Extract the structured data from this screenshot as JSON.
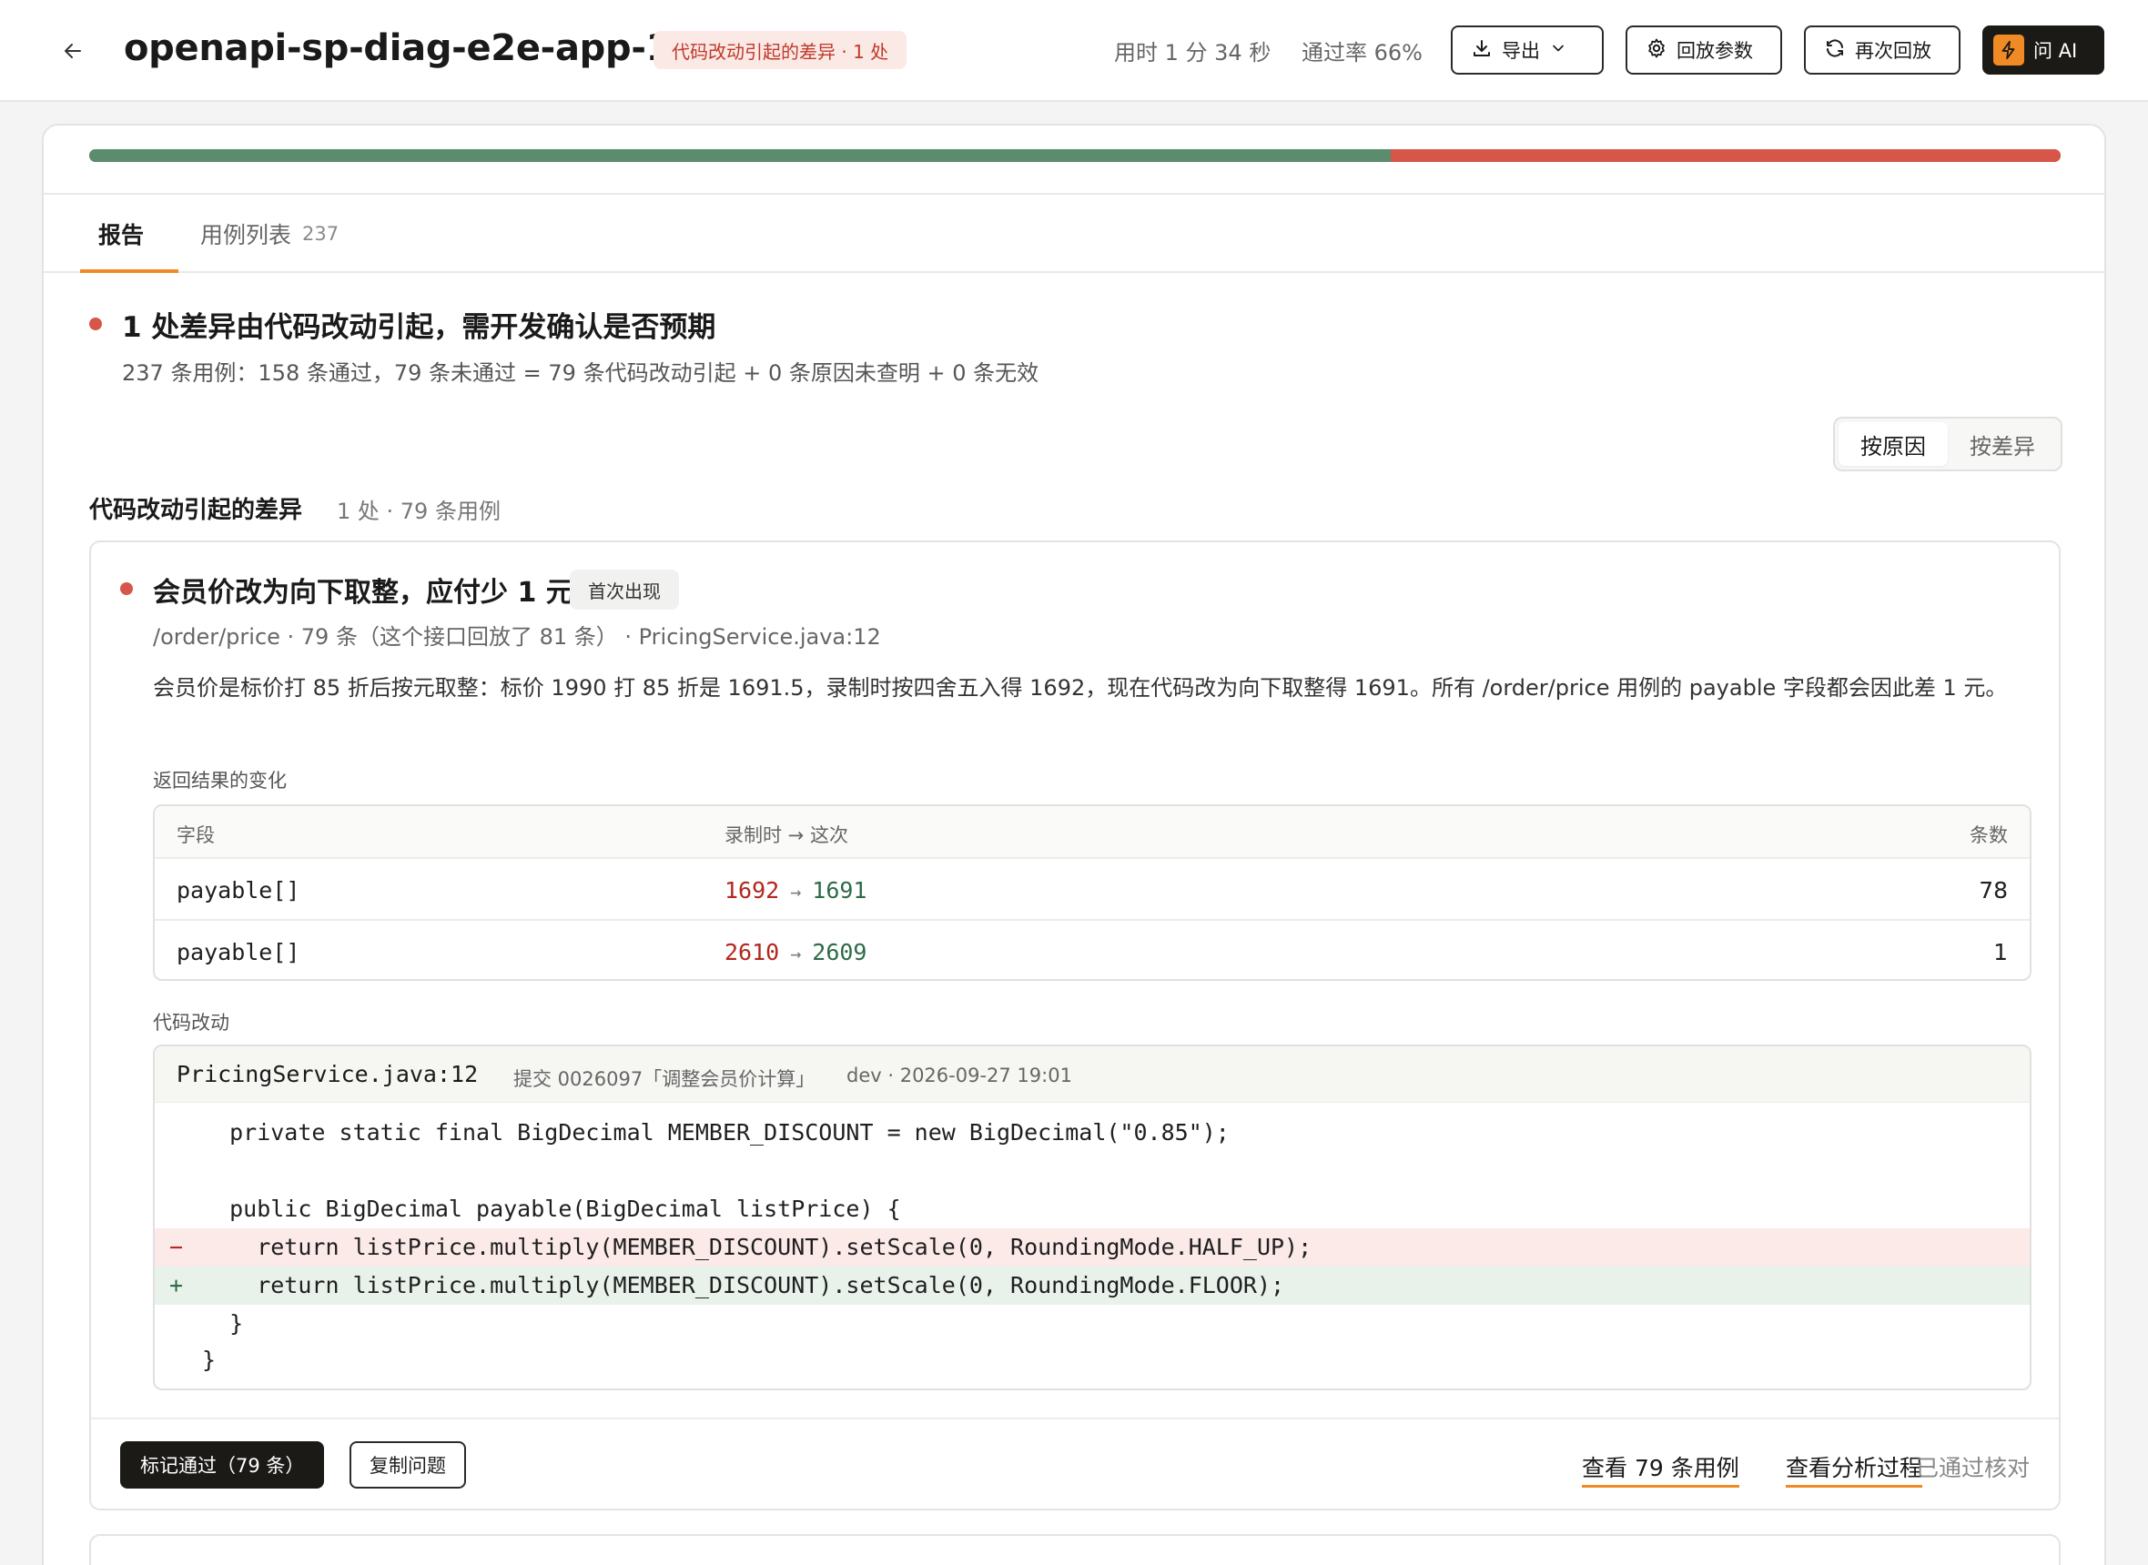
{
  "header": {
    "title": "openapi-sp-diag-e2e-app-130",
    "badge": "代码改动引起的差异 · 1 处",
    "duration": "用时 1 分 34 秒",
    "pass_rate": "通过率 66%",
    "buttons": {
      "export": "导出",
      "params": "回放参数",
      "replay": "再次回放",
      "ai": "问 AI"
    }
  },
  "progress": {
    "pass_fraction": 0.66,
    "pass_color": "#5b8c6d",
    "fail_color": "#d6574a"
  },
  "tabs": [
    {
      "label": "报告"
    },
    {
      "label": "用例列表",
      "count": "237"
    }
  ],
  "summary": {
    "title": "1 处差异由代码改动引起，需开发确认是否预期",
    "subtitle": "237 条用例：158 条通过，79 条未通过 = 79 条代码改动引起 + 0 条原因未查明 + 0 条无效"
  },
  "view_toggle": {
    "by_cause": "按原因",
    "by_diff": "按差异"
  },
  "section": {
    "title": "代码改动引起的差异",
    "meta": "1 处 · 79 条用例"
  },
  "issue": {
    "title": "会员价改为向下取整，应付少 1 元",
    "badge": "首次出现",
    "path": "/order/price · 79 条（这个接口回放了 81 条） · PricingService.java:12",
    "description": "会员价是标价打 85 折后按元取整：标价 1990 打 85 折是 1691.5，录制时按四舍五入得 1692，现在代码改为向下取整得 1691。所有 /order/price 用例的 payable 字段都会因此差 1 元。",
    "changes_label": "返回结果的变化",
    "table": {
      "headers": {
        "field": "字段",
        "change": "录制时 → 这次",
        "count": "条数"
      },
      "rows": [
        {
          "field": "payable[]",
          "old": "1692",
          "new": "1691",
          "count": "78"
        },
        {
          "field": "payable[]",
          "old": "2610",
          "new": "2609",
          "count": "1"
        }
      ],
      "arrow": "→"
    },
    "code_label": "代码改动",
    "code": {
      "file": "PricingService.java:12",
      "commit": "提交 0026097「调整会员价计算」",
      "branch": "dev · 2026-09-27 19:01",
      "lines": [
        {
          "marker": "",
          "text": "  private static final BigDecimal MEMBER_DISCOUNT = new BigDecimal(\"0.85\");",
          "kind": "ctx"
        },
        {
          "marker": "",
          "text": "",
          "kind": "ctx"
        },
        {
          "marker": "",
          "text": "  public BigDecimal payable(BigDecimal listPrice) {",
          "kind": "ctx"
        },
        {
          "marker": "−",
          "text": "    return listPrice.multiply(MEMBER_DISCOUNT).setScale(0, RoundingMode.HALF_UP);",
          "kind": "del"
        },
        {
          "marker": "+",
          "text": "    return listPrice.multiply(MEMBER_DISCOUNT).setScale(0, RoundingMode.FLOOR);",
          "kind": "add"
        },
        {
          "marker": "",
          "text": "  }",
          "kind": "ctx"
        },
        {
          "marker": "",
          "text": "}",
          "kind": "ctx"
        }
      ]
    },
    "footer": {
      "mark_pass": "标记通过（79 条）",
      "copy": "复制问题",
      "view_cases": "查看 79 条用例",
      "view_analysis": "查看分析过程",
      "status": "已通过核对"
    }
  }
}
